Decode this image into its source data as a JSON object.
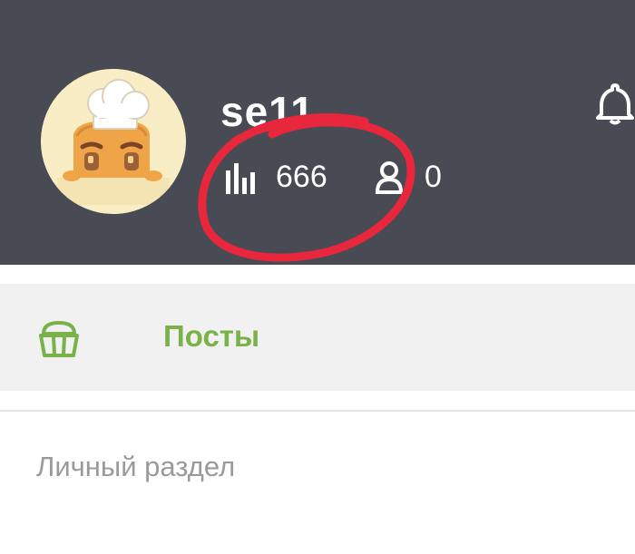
{
  "profile": {
    "username": "se11",
    "views_count": "666",
    "followers_count": "0",
    "avatar_icon": "chef-bread-avatar-icon",
    "notification_icon": "bell-icon",
    "views_icon": "bar-chart-icon",
    "followers_icon": "user-icon"
  },
  "menu": {
    "posts_label": "Посты",
    "posts_icon": "muffin-basket-icon",
    "personal_section_label": "Личный раздел"
  },
  "colors": {
    "header_bg": "#484b53",
    "accent": "#7ab24a",
    "annotation": "#e8263c",
    "row_bg": "#f1f1f1"
  }
}
